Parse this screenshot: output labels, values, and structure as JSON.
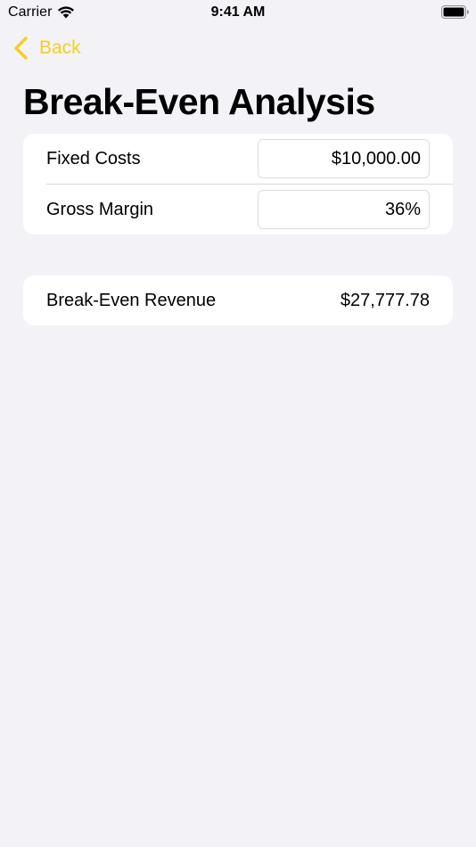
{
  "status_bar": {
    "carrier": "Carrier",
    "time": "9:41 AM",
    "wifi_icon": "wifi-icon",
    "battery_icon": "battery-icon"
  },
  "nav": {
    "back_label": "Back",
    "back_icon": "chevron-left-icon",
    "accent_color": "#f5cf1f"
  },
  "page": {
    "title": "Break-Even Analysis"
  },
  "inputs": {
    "fixed_costs": {
      "label": "Fixed Costs",
      "value": "$10,000.00"
    },
    "gross_margin": {
      "label": "Gross Margin",
      "value": "36%"
    }
  },
  "result": {
    "label": "Break-Even Revenue",
    "value": "$27,777.78"
  },
  "colors": {
    "background": "#f2f2f7",
    "card": "#ffffff",
    "text": "#000000"
  }
}
